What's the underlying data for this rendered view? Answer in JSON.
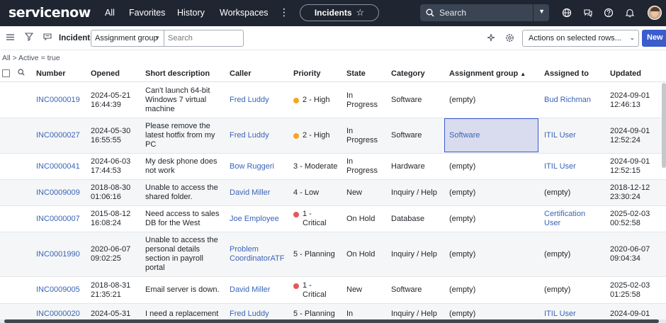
{
  "brand": {
    "logo_text": "servicenow",
    "accent": "#62d84e"
  },
  "nav": {
    "links": [
      "All",
      "Favorites",
      "History",
      "Workspaces"
    ],
    "more_icon": "more-vertical-icon",
    "current": "Incidents",
    "search_placeholder": "Search",
    "icons": [
      "globe-icon",
      "chat-icon",
      "help-icon",
      "bell-icon",
      "user-avatar"
    ]
  },
  "toolbar": {
    "label": "Incidents",
    "filter_field": "Assignment group",
    "search_placeholder": "Search",
    "actions_label": "Actions on selected rows...",
    "new_label": "New",
    "icons": [
      "menu-icon",
      "filter-icon",
      "comment-icon",
      "sparkle-icon",
      "gear-icon"
    ]
  },
  "breadcrumb": "All > Active = true",
  "table": {
    "columns": [
      "Number",
      "Opened",
      "Short description",
      "Caller",
      "Priority",
      "State",
      "Category",
      "Assignment group",
      "Assigned to",
      "Updated"
    ],
    "sort_indicator": "▲",
    "rows": [
      {
        "number": "INC0000019",
        "opened": [
          "2024-05-21",
          "16:44:39"
        ],
        "desc": [
          "Can't launch 64-bit",
          "Windows 7 virtual",
          "machine"
        ],
        "caller": [
          "Fred Luddy"
        ],
        "priority": [
          "2 - High"
        ],
        "priority_color": "#f5a623",
        "state": [
          "In",
          "Progress"
        ],
        "category": "Software",
        "group": "(empty)",
        "assigned": [
          "Bud Richman"
        ],
        "assigned_link": true,
        "updated": [
          "2024-09-01",
          "12:46:13"
        ]
      },
      {
        "number": "INC0000027",
        "opened": [
          "2024-05-30",
          "16:55:55"
        ],
        "desc": [
          "Please remove the",
          "latest hotfix from my",
          "PC"
        ],
        "caller": [
          "Fred Luddy"
        ],
        "priority": [
          "2 - High"
        ],
        "priority_color": "#f5a623",
        "state": [
          "In",
          "Progress"
        ],
        "category": "Software",
        "group": "Software",
        "assigned": [
          "ITIL User"
        ],
        "assigned_link": true,
        "updated": [
          "2024-09-01",
          "12:52:24"
        ]
      },
      {
        "number": "INC0000041",
        "opened": [
          "2024-06-03",
          "17:44:53"
        ],
        "desc": [
          "My desk phone does",
          "not work"
        ],
        "caller": [
          "Bow Ruggeri"
        ],
        "priority": [
          "3 - Moderate"
        ],
        "priority_color": "",
        "state": [
          "In",
          "Progress"
        ],
        "category": "Hardware",
        "group": "(empty)",
        "assigned": [
          "ITIL User"
        ],
        "assigned_link": true,
        "updated": [
          "2024-09-01",
          "12:52:15"
        ]
      },
      {
        "number": "INC0009009",
        "opened": [
          "2018-08-30",
          "01:06:16"
        ],
        "desc": [
          "Unable to access the",
          "shared folder."
        ],
        "caller": [
          "David Miller"
        ],
        "priority": [
          "4 - Low"
        ],
        "priority_color": "",
        "state": [
          "New"
        ],
        "category": "Inquiry / Help",
        "group": "(empty)",
        "assigned": [
          "(empty)"
        ],
        "assigned_link": false,
        "updated": [
          "2018-12-12",
          "23:30:24"
        ]
      },
      {
        "number": "INC0000007",
        "opened": [
          "2015-08-12",
          "16:08:24"
        ],
        "desc": [
          "Need access to sales",
          "DB for the West"
        ],
        "caller": [
          "Joe Employee"
        ],
        "priority": [
          "1 -",
          "Critical"
        ],
        "priority_color": "#e5575c",
        "state": [
          "On Hold"
        ],
        "category": "Database",
        "group": "(empty)",
        "assigned": [
          "Certification",
          "User"
        ],
        "assigned_link": true,
        "updated": [
          "2025-02-03",
          "00:52:58"
        ]
      },
      {
        "number": "INC0001990",
        "opened": [
          "2020-06-07",
          "09:02:25"
        ],
        "desc": [
          "Unable to access the",
          "personal details",
          "section in payroll",
          "portal"
        ],
        "caller": [
          "Problem",
          "CoordinatorATF"
        ],
        "priority": [
          "5 - Planning"
        ],
        "priority_color": "",
        "state": [
          "On Hold"
        ],
        "category": "Inquiry / Help",
        "group": "(empty)",
        "assigned": [
          "(empty)"
        ],
        "assigned_link": false,
        "updated": [
          "2020-06-07",
          "09:04:34"
        ]
      },
      {
        "number": "INC0009005",
        "opened": [
          "2018-08-31",
          "21:35:21"
        ],
        "desc": [
          "Email server is down."
        ],
        "caller": [
          "David Miller"
        ],
        "priority": [
          "1 -",
          "Critical"
        ],
        "priority_color": "#e5575c",
        "state": [
          "New"
        ],
        "category": "Software",
        "group": "(empty)",
        "assigned": [
          "(empty)"
        ],
        "assigned_link": false,
        "updated": [
          "2025-02-03",
          "01:25:58"
        ]
      },
      {
        "number": "INC0000020",
        "opened": [
          "2024-05-31",
          ""
        ],
        "desc": [
          "I need a replacement",
          ""
        ],
        "caller": [
          "Fred Luddy"
        ],
        "priority": [
          "5 - Planning"
        ],
        "priority_color": "",
        "state": [
          "In",
          ""
        ],
        "category": "Inquiry / Help",
        "group": "(empty)",
        "assigned": [
          "ITIL User"
        ],
        "assigned_link": true,
        "updated": [
          "2024-09-01",
          ""
        ]
      }
    ]
  }
}
